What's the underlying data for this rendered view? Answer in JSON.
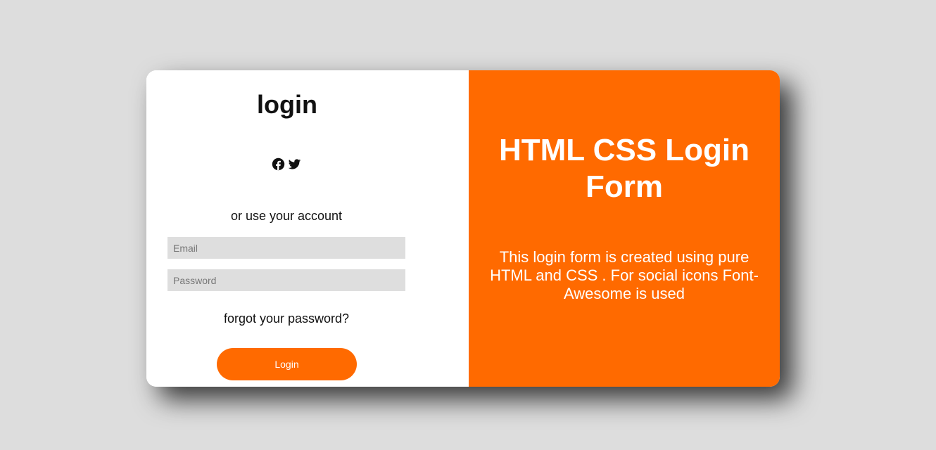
{
  "login_panel": {
    "title": "login",
    "social": {
      "facebook_icon": "facebook-icon",
      "twitter_icon": "twitter-icon"
    },
    "alt_text": "or use your account",
    "email": {
      "value": "",
      "placeholder": "Email"
    },
    "password": {
      "value": "",
      "placeholder": "Password"
    },
    "forgot_link": "forgot your password?",
    "login_button": "Login"
  },
  "info_panel": {
    "title": "HTML CSS Login Form",
    "description": "This login form is created using pure HTML and CSS . For social icons Font-Awesome is used"
  },
  "colors": {
    "background": "#dddddd",
    "accent": "#ff6a00",
    "input_bg": "#dedede"
  }
}
